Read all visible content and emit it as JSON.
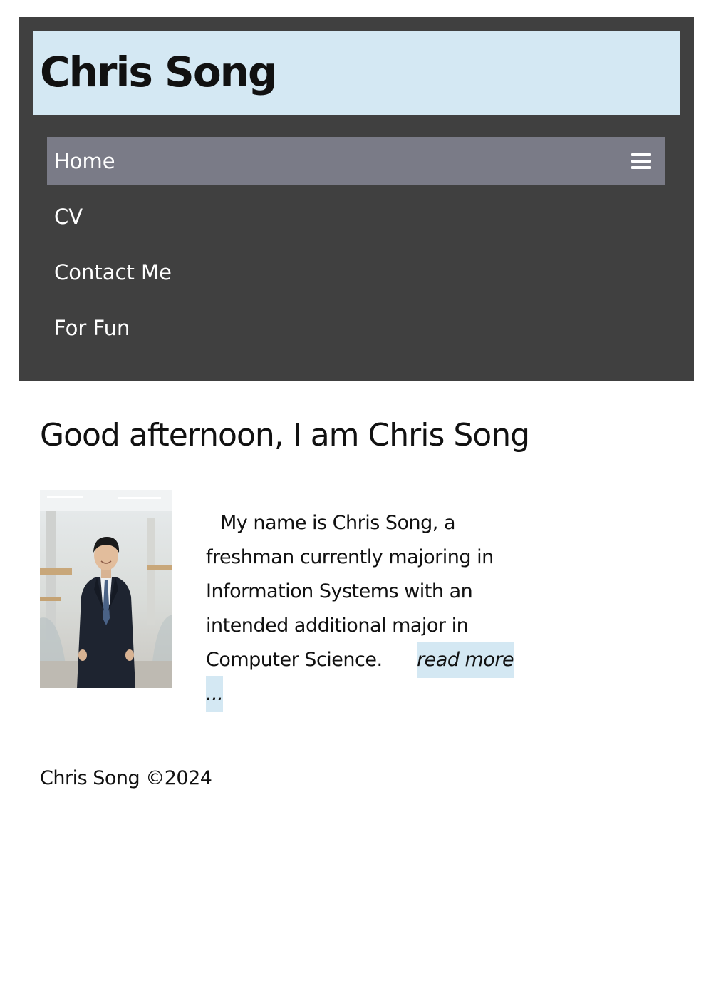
{
  "site": {
    "title": "Chris Song"
  },
  "nav": {
    "items": [
      {
        "label": "Home"
      },
      {
        "label": "CV"
      },
      {
        "label": "Contact Me"
      },
      {
        "label": "For Fun"
      }
    ],
    "menu_icon": "hamburger-menu-icon"
  },
  "main": {
    "greeting": "Good afternoon, I am Chris Song",
    "intro_text": "My name is Chris Song, a freshman currently majoring in Information Systems with an intended additional major in Computer Science.",
    "read_more_label": "read more ...",
    "portrait_description": "portrait photo"
  },
  "footer": {
    "text": "Chris Song ©2024"
  },
  "colors": {
    "header_bg": "#404040",
    "title_bar_bg": "#d4e8f3",
    "nav_active_bg": "#7a7b87",
    "read_more_bg": "#d4e8f3"
  }
}
